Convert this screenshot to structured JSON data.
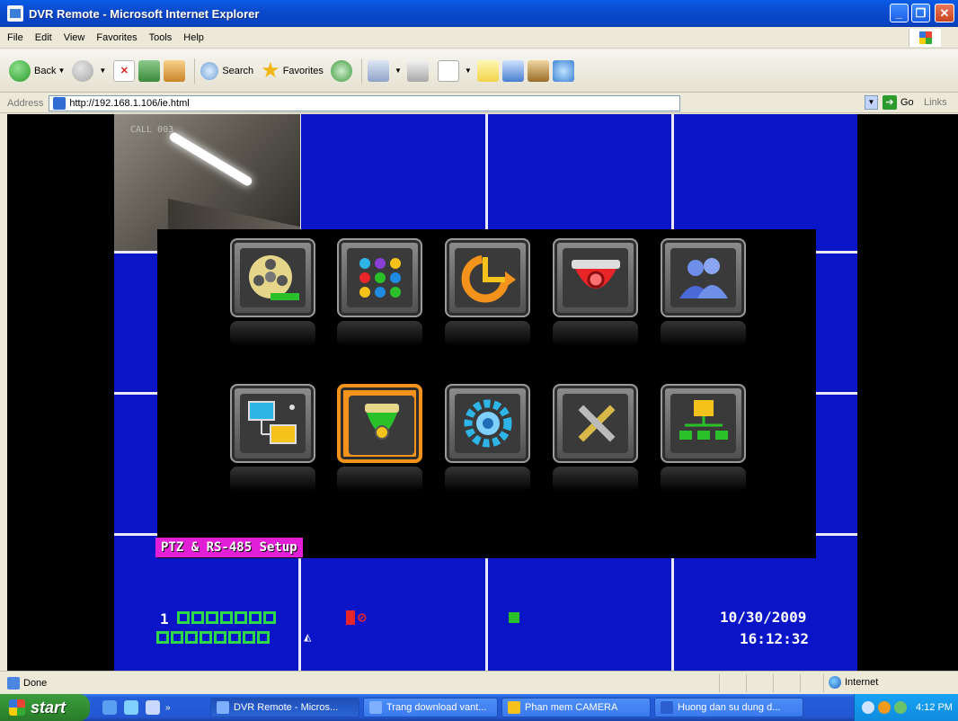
{
  "window": {
    "title": "DVR Remote - Microsoft Internet Explorer"
  },
  "menu": [
    "File",
    "Edit",
    "View",
    "Favorites",
    "Tools",
    "Help"
  ],
  "toolbar": {
    "back": "Back",
    "search": "Search",
    "favorites": "Favorites"
  },
  "address": {
    "label": "Address",
    "url": "http://192.168.1.106/ie.html",
    "go": "Go",
    "links": "Links"
  },
  "camera": {
    "overlay_text": "CALL 003"
  },
  "dvr_menu": {
    "selected_label": "PTZ & RS-485 Setup",
    "icons_row1": [
      "film-reel-icon",
      "color-dots-icon",
      "clock-arrow-icon",
      "dome-camera-icon",
      "users-icon"
    ],
    "icons_row2": [
      "network-computers-icon",
      "ptz-camera-icon",
      "gear-icon",
      "tools-icon",
      "hierarchy-icon"
    ],
    "selected_index": 6
  },
  "osd": {
    "channel": "1",
    "date": "10/30/2009",
    "time": "16:12:32"
  },
  "statusbar": {
    "status": "Done",
    "zone": "Internet"
  },
  "taskbar": {
    "start": "start",
    "tasks": [
      "DVR Remote - Micros...",
      "Trang download vant...",
      "Phan mem CAMERA",
      "Huong dan su dung d..."
    ],
    "clock": "4:12 PM"
  },
  "colors": {
    "grid_blue": "#0b15c8",
    "selected_orange": "#f3931c",
    "label_magenta": "#e21fd6",
    "osd_green": "#2fd84a"
  }
}
